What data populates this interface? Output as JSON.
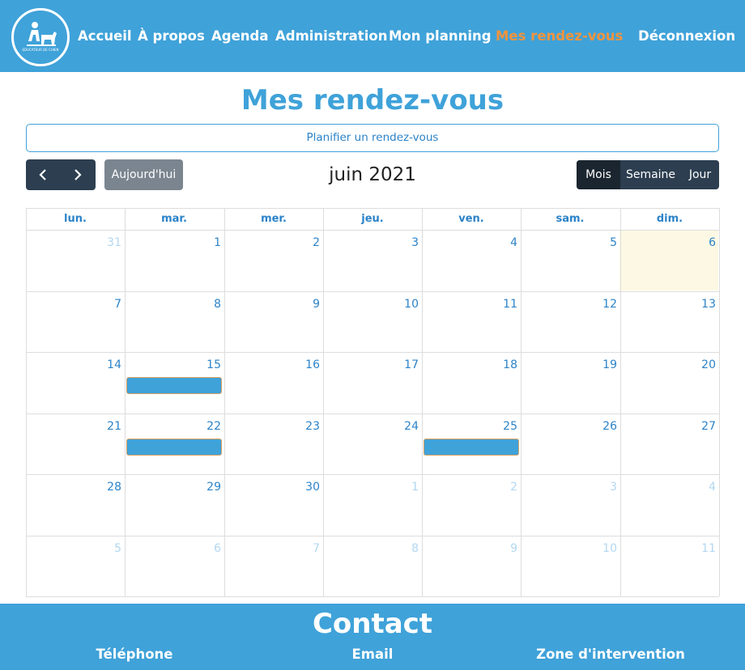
{
  "nav": {
    "items": [
      {
        "label": "Accueil",
        "active": false
      },
      {
        "label": "À propos",
        "active": false
      },
      {
        "label": "Agenda",
        "active": false
      },
      {
        "label": "Administration",
        "active": false
      },
      {
        "label": "Mon planning",
        "active": false
      },
      {
        "label": "Mes rendez-vous",
        "active": true
      }
    ],
    "logout_label": "Déconnexion",
    "logo_text": "EDUCATEUR DE CHIEN",
    "colors": {
      "bar": "#3fa2d9",
      "active": "#f0943e",
      "text": "#ffffff"
    }
  },
  "page": {
    "title": "Mes rendez-vous"
  },
  "actions": {
    "plan_button": "Planifier un rendez-vous"
  },
  "calendar": {
    "title": "juin 2021",
    "today_label": "Aujourd'hui",
    "prev_icon": "chevron-left-icon",
    "next_icon": "chevron-right-icon",
    "views": [
      {
        "label": "Mois",
        "active": true
      },
      {
        "label": "Semaine",
        "active": false
      },
      {
        "label": "Jour",
        "active": false
      }
    ],
    "weekdays": [
      "lun.",
      "mar.",
      "mer.",
      "jeu.",
      "ven.",
      "sam.",
      "dim."
    ],
    "weeks": [
      [
        {
          "d": "31",
          "other": true
        },
        {
          "d": "1"
        },
        {
          "d": "2"
        },
        {
          "d": "3"
        },
        {
          "d": "4"
        },
        {
          "d": "5"
        },
        {
          "d": "6",
          "today": true
        }
      ],
      [
        {
          "d": "7"
        },
        {
          "d": "8"
        },
        {
          "d": "9"
        },
        {
          "d": "10"
        },
        {
          "d": "11"
        },
        {
          "d": "12"
        },
        {
          "d": "13"
        }
      ],
      [
        {
          "d": "14"
        },
        {
          "d": "15",
          "event": true
        },
        {
          "d": "16"
        },
        {
          "d": "17"
        },
        {
          "d": "18"
        },
        {
          "d": "19"
        },
        {
          "d": "20"
        }
      ],
      [
        {
          "d": "21"
        },
        {
          "d": "22",
          "event": true
        },
        {
          "d": "23"
        },
        {
          "d": "24"
        },
        {
          "d": "25",
          "event": true
        },
        {
          "d": "26"
        },
        {
          "d": "27"
        }
      ],
      [
        {
          "d": "28"
        },
        {
          "d": "29"
        },
        {
          "d": "30"
        },
        {
          "d": "1",
          "other": true
        },
        {
          "d": "2",
          "other": true
        },
        {
          "d": "3",
          "other": true
        },
        {
          "d": "4",
          "other": true
        }
      ],
      [
        {
          "d": "5",
          "other": true
        },
        {
          "d": "6",
          "other": true
        },
        {
          "d": "7",
          "other": true
        },
        {
          "d": "8",
          "other": true
        },
        {
          "d": "9",
          "other": true
        },
        {
          "d": "10",
          "other": true
        },
        {
          "d": "11",
          "other": true
        }
      ]
    ],
    "colors": {
      "event": "#3fa2d9",
      "event_border": "#d8a060",
      "today_bg": "#fcf8e3",
      "day_number": "#2c83c8",
      "other_month": "#b3d7f0"
    }
  },
  "footer": {
    "title": "Contact",
    "columns": [
      "Téléphone",
      "Email",
      "Zone d'intervention"
    ]
  }
}
